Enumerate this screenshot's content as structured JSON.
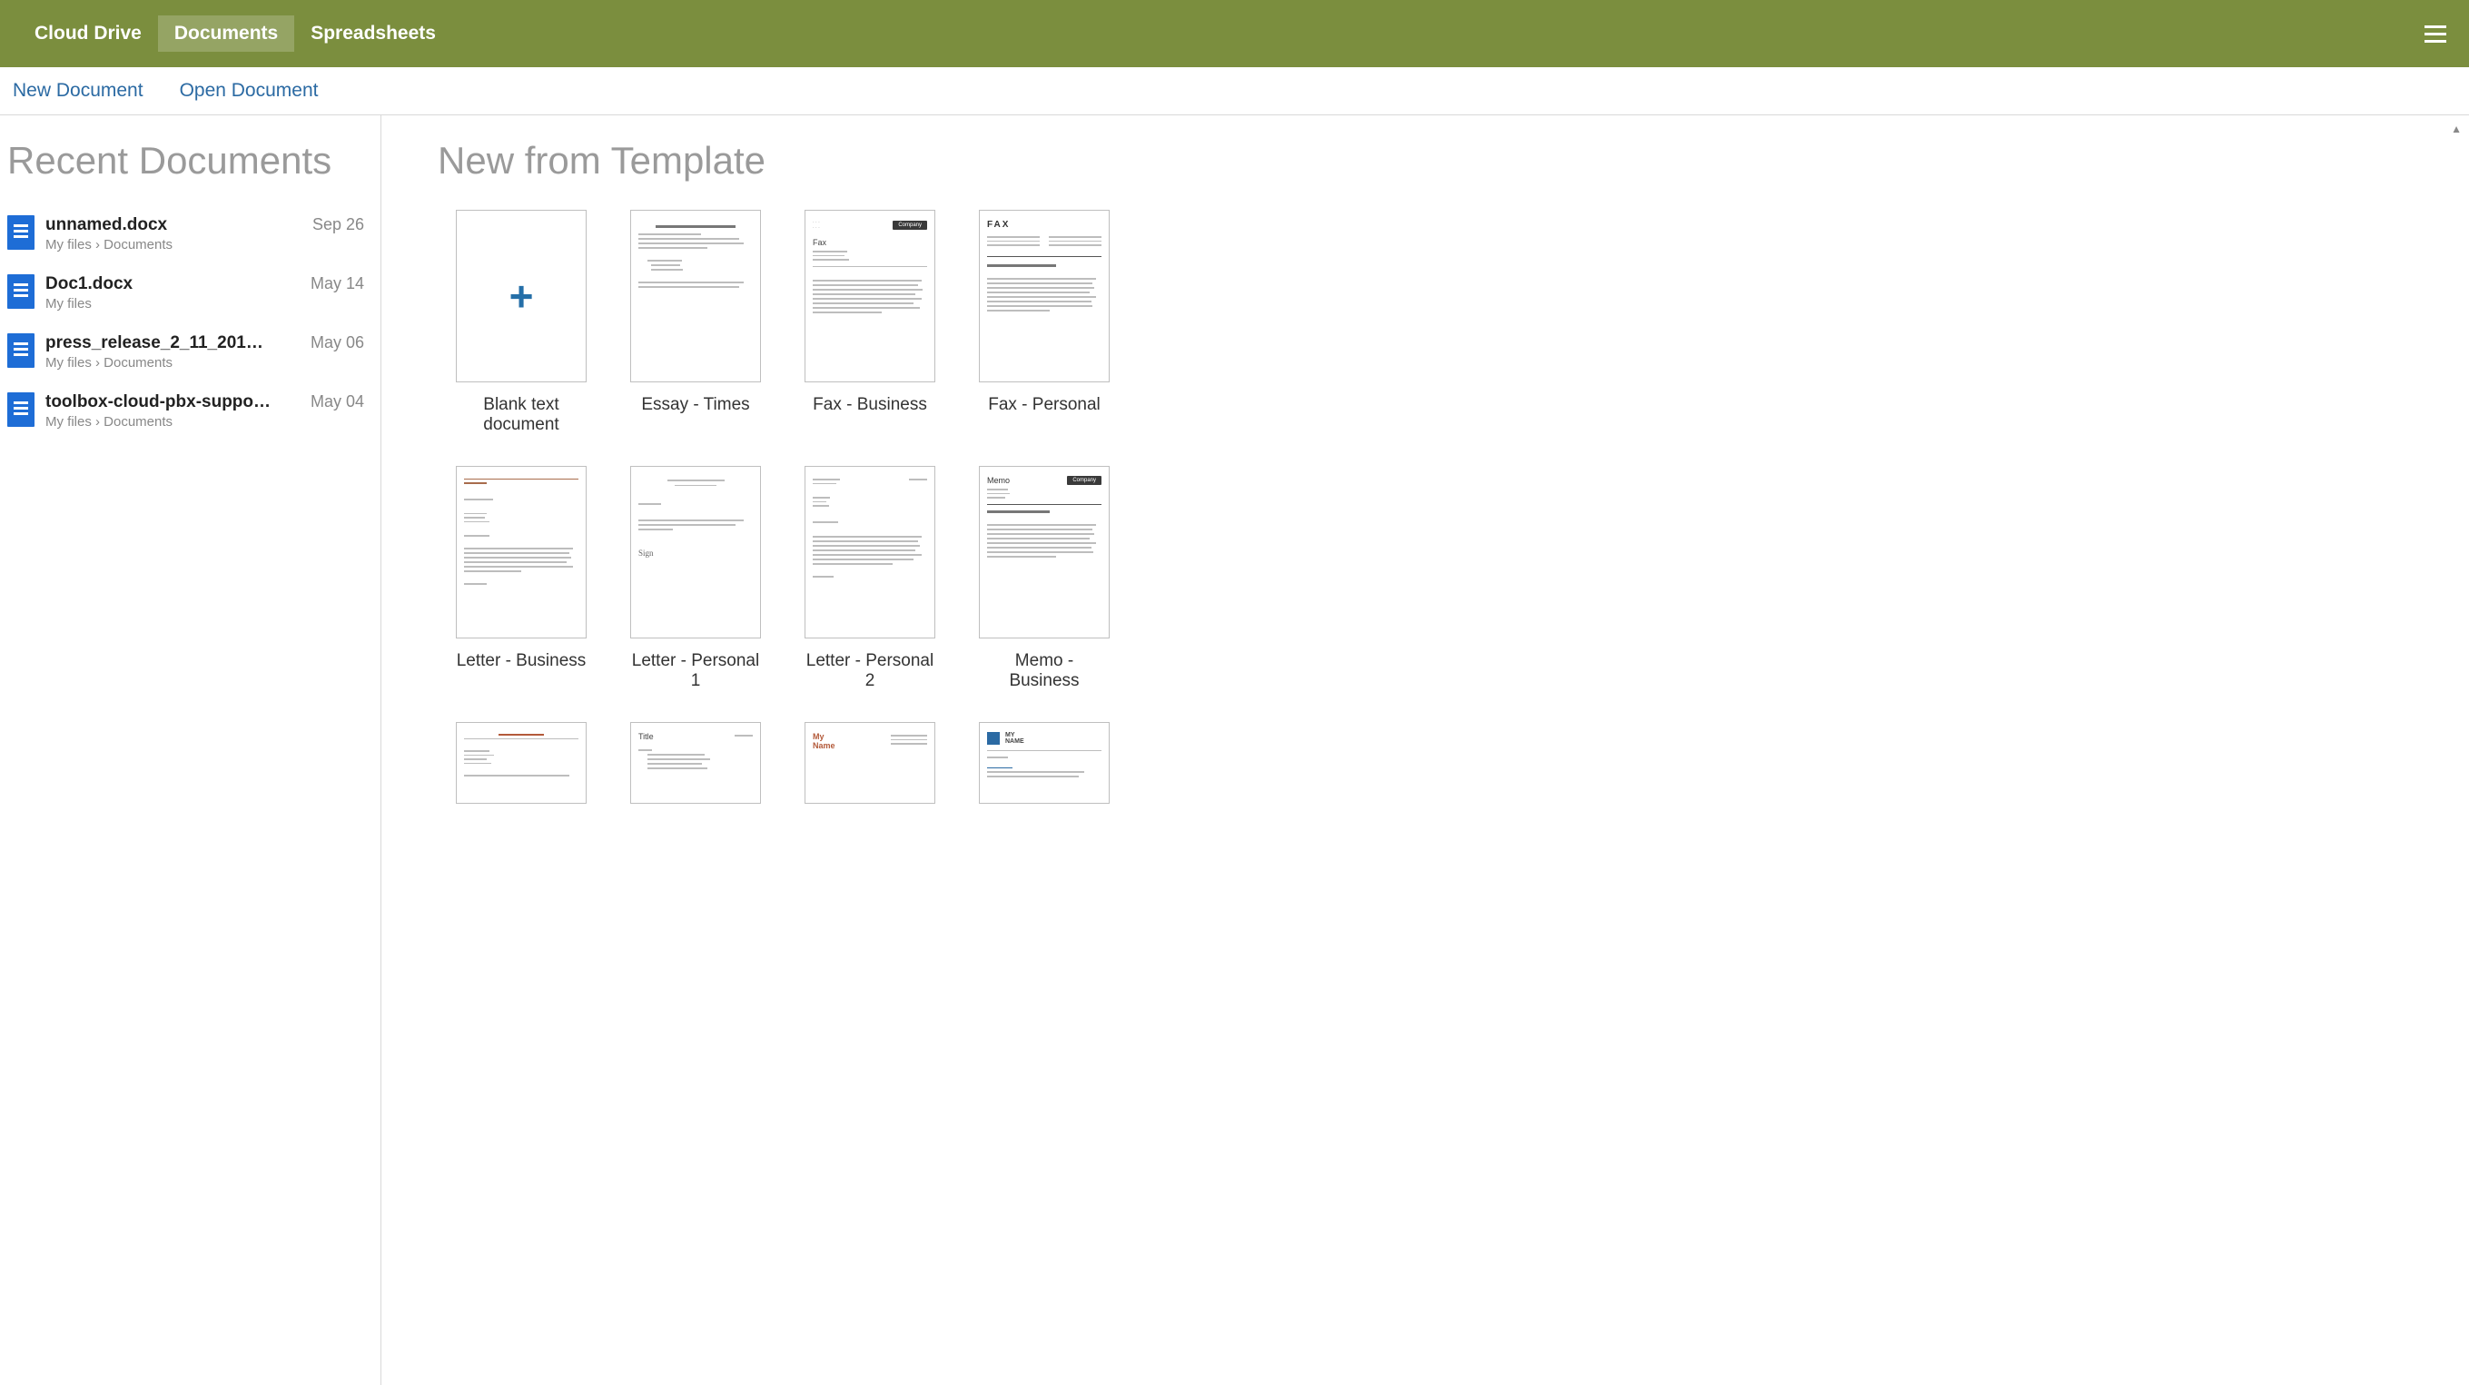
{
  "header": {
    "tabs": [
      {
        "label": "Cloud Drive",
        "active": false
      },
      {
        "label": "Documents",
        "active": true
      },
      {
        "label": "Spreadsheets",
        "active": false
      }
    ]
  },
  "subbar": {
    "new_doc": "New Document",
    "open_doc": "Open Document"
  },
  "sidebar": {
    "title": "Recent Documents",
    "items": [
      {
        "name": "unnamed.docx",
        "path": "My files › Documents",
        "date": "Sep 26"
      },
      {
        "name": "Doc1.docx",
        "path": "My files",
        "date": "May 14"
      },
      {
        "name": "press_release_2_11_2016.docx",
        "path": "My files › Documents",
        "date": "May 06"
      },
      {
        "name": "toolbox-cloud-pbx-supported-d…",
        "path": "My files › Documents",
        "date": "May 04"
      }
    ]
  },
  "content": {
    "title": "New from Template",
    "templates": [
      {
        "label": "Blank text document",
        "kind": "blank"
      },
      {
        "label": "Essay - Times",
        "kind": "essay"
      },
      {
        "label": "Fax - Business",
        "kind": "fax-biz",
        "chip": "Company",
        "heading": "Fax"
      },
      {
        "label": "Fax - Personal",
        "kind": "fax-pers",
        "heading": "FAX"
      },
      {
        "label": "Letter - Business",
        "kind": "letter-biz"
      },
      {
        "label": "Letter - Personal 1",
        "kind": "letter-p1"
      },
      {
        "label": "Letter - Personal 2",
        "kind": "letter-p2"
      },
      {
        "label": "Memo - Business",
        "kind": "memo",
        "chip": "Company",
        "heading": "Memo"
      },
      {
        "label": "",
        "kind": "extra1"
      },
      {
        "label": "",
        "kind": "extra2",
        "heading": "Title"
      },
      {
        "label": "",
        "kind": "extra3",
        "heading": "My\nName"
      },
      {
        "label": "",
        "kind": "extra4",
        "heading": "MY\nNAME"
      }
    ]
  }
}
